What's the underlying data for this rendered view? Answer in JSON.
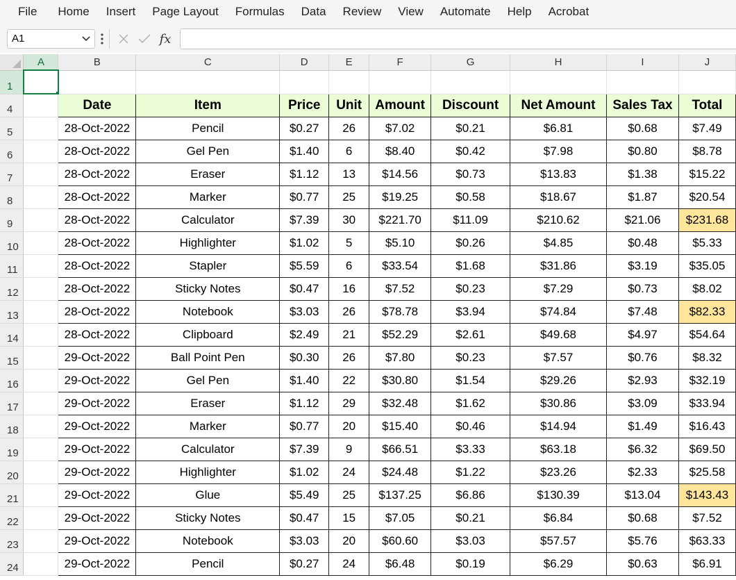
{
  "menu": [
    "File",
    "Home",
    "Insert",
    "Page Layout",
    "Formulas",
    "Data",
    "Review",
    "View",
    "Automate",
    "Help",
    "Acrobat"
  ],
  "formula_bar": {
    "name_box": "A1",
    "formula": "",
    "icons": [
      "more-options-icon",
      "cancel-x-icon",
      "confirm-check-icon",
      "insert-function-fx-icon"
    ]
  },
  "columns": [
    "A",
    "B",
    "C",
    "D",
    "E",
    "F",
    "G",
    "H",
    "I",
    "J"
  ],
  "active_cell": {
    "column": "A",
    "row": "1"
  },
  "empty_row": "1",
  "header_row": {
    "row": "4",
    "cells": [
      "Date",
      "Item",
      "Price",
      "Unit",
      "Amount",
      "Discount",
      "Net Amount",
      "Sales Tax",
      "Total"
    ]
  },
  "rows": [
    {
      "row": "5",
      "cells": [
        "28-Oct-2022",
        "Pencil",
        "$0.27",
        "26",
        "$7.02",
        "$0.21",
        "$6.81",
        "$0.68",
        "$7.49"
      ]
    },
    {
      "row": "6",
      "cells": [
        "28-Oct-2022",
        "Gel Pen",
        "$1.40",
        "6",
        "$8.40",
        "$0.42",
        "$7.98",
        "$0.80",
        "$8.78"
      ]
    },
    {
      "row": "7",
      "cells": [
        "28-Oct-2022",
        "Eraser",
        "$1.12",
        "13",
        "$14.56",
        "$0.73",
        "$13.83",
        "$1.38",
        "$15.22"
      ]
    },
    {
      "row": "8",
      "cells": [
        "28-Oct-2022",
        "Marker",
        "$0.77",
        "25",
        "$19.25",
        "$0.58",
        "$18.67",
        "$1.87",
        "$20.54"
      ]
    },
    {
      "row": "9",
      "cells": [
        "28-Oct-2022",
        "Calculator",
        "$7.39",
        "30",
        "$221.70",
        "$11.09",
        "$210.62",
        "$21.06",
        "$231.68"
      ],
      "highlight_total": true
    },
    {
      "row": "10",
      "cells": [
        "28-Oct-2022",
        "Highlighter",
        "$1.02",
        "5",
        "$5.10",
        "$0.26",
        "$4.85",
        "$0.48",
        "$5.33"
      ]
    },
    {
      "row": "11",
      "cells": [
        "28-Oct-2022",
        "Stapler",
        "$5.59",
        "6",
        "$33.54",
        "$1.68",
        "$31.86",
        "$3.19",
        "$35.05"
      ]
    },
    {
      "row": "12",
      "cells": [
        "28-Oct-2022",
        "Sticky Notes",
        "$0.47",
        "16",
        "$7.52",
        "$0.23",
        "$7.29",
        "$0.73",
        "$8.02"
      ]
    },
    {
      "row": "13",
      "cells": [
        "28-Oct-2022",
        "Notebook",
        "$3.03",
        "26",
        "$78.78",
        "$3.94",
        "$74.84",
        "$7.48",
        "$82.33"
      ],
      "highlight_total": true
    },
    {
      "row": "14",
      "cells": [
        "28-Oct-2022",
        "Clipboard",
        "$2.49",
        "21",
        "$52.29",
        "$2.61",
        "$49.68",
        "$4.97",
        "$54.64"
      ]
    },
    {
      "row": "15",
      "cells": [
        "29-Oct-2022",
        "Ball Point Pen",
        "$0.30",
        "26",
        "$7.80",
        "$0.23",
        "$7.57",
        "$0.76",
        "$8.32"
      ]
    },
    {
      "row": "16",
      "cells": [
        "29-Oct-2022",
        "Gel Pen",
        "$1.40",
        "22",
        "$30.80",
        "$1.54",
        "$29.26",
        "$2.93",
        "$32.19"
      ]
    },
    {
      "row": "17",
      "cells": [
        "29-Oct-2022",
        "Eraser",
        "$1.12",
        "29",
        "$32.48",
        "$1.62",
        "$30.86",
        "$3.09",
        "$33.94"
      ]
    },
    {
      "row": "18",
      "cells": [
        "29-Oct-2022",
        "Marker",
        "$0.77",
        "20",
        "$15.40",
        "$0.46",
        "$14.94",
        "$1.49",
        "$16.43"
      ]
    },
    {
      "row": "19",
      "cells": [
        "29-Oct-2022",
        "Calculator",
        "$7.39",
        "9",
        "$66.51",
        "$3.33",
        "$63.18",
        "$6.32",
        "$69.50"
      ]
    },
    {
      "row": "20",
      "cells": [
        "29-Oct-2022",
        "Highlighter",
        "$1.02",
        "24",
        "$24.48",
        "$1.22",
        "$23.26",
        "$2.33",
        "$25.58"
      ]
    },
    {
      "row": "21",
      "cells": [
        "29-Oct-2022",
        "Glue",
        "$5.49",
        "25",
        "$137.25",
        "$6.86",
        "$130.39",
        "$13.04",
        "$143.43"
      ],
      "highlight_total": true
    },
    {
      "row": "22",
      "cells": [
        "29-Oct-2022",
        "Sticky Notes",
        "$0.47",
        "15",
        "$7.05",
        "$0.21",
        "$6.84",
        "$0.68",
        "$7.52"
      ]
    },
    {
      "row": "23",
      "cells": [
        "29-Oct-2022",
        "Notebook",
        "$3.03",
        "20",
        "$60.60",
        "$3.03",
        "$57.57",
        "$5.76",
        "$63.33"
      ]
    },
    {
      "row": "24",
      "cells": [
        "29-Oct-2022",
        "Pencil",
        "$0.27",
        "24",
        "$6.48",
        "$0.19",
        "$6.29",
        "$0.63",
        "$6.91"
      ]
    }
  ],
  "colors": {
    "header_fill": "#eafdd7",
    "highlight_fill": "#ffe69a",
    "selection": "#137e43"
  }
}
